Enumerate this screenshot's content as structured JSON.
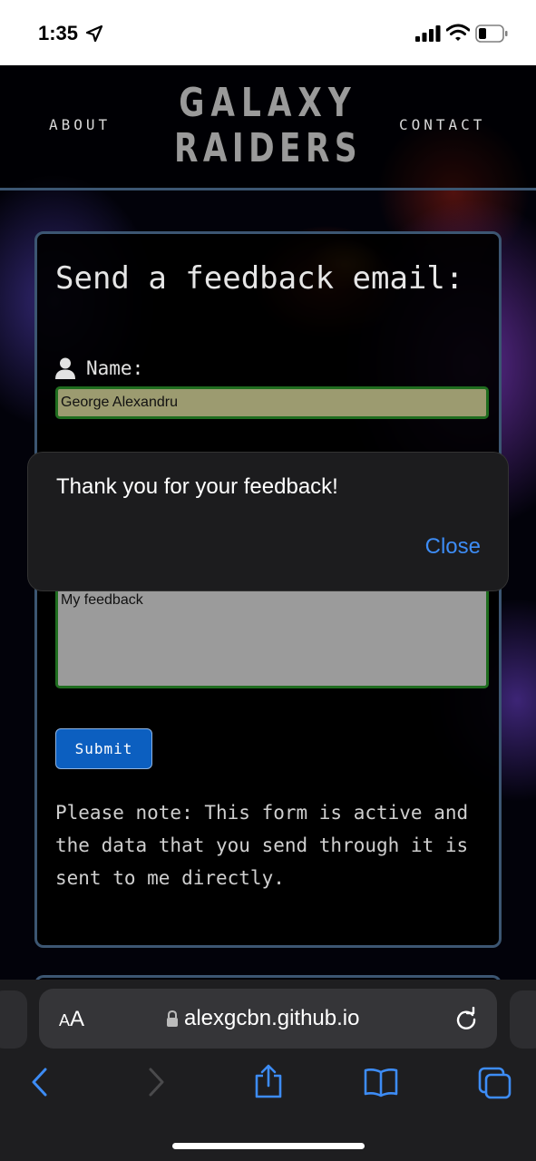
{
  "status_bar": {
    "time": "1:35"
  },
  "site": {
    "nav_about": "ABOUT",
    "nav_contact": "CONTACT",
    "logo_line1": "GALAXY",
    "logo_line2": "RAIDERS"
  },
  "form": {
    "title": "Send a feedback email:",
    "name_label": "Name:",
    "name_value": "George Alexandru",
    "feedback_value": "My feedback",
    "submit_label": "Submit",
    "note": "Please note: This form is active and the data that you send through it is sent to me directly."
  },
  "alert": {
    "message": "Thank you for your feedback!",
    "close_label": "Close"
  },
  "browser": {
    "aa_small": "A",
    "aa_large": "A",
    "url": "alexgcbn.github.io"
  },
  "colors": {
    "accent": "#3d8cf5",
    "card_border": "#3c5672",
    "submit_bg": "#0c5fc0",
    "input_border": "#1f6d1f"
  }
}
